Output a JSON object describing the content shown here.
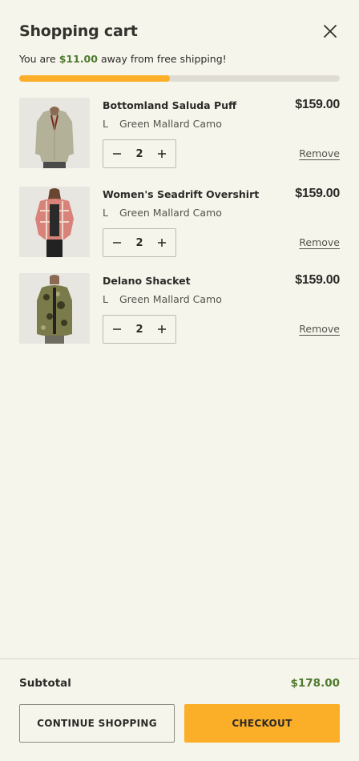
{
  "cart": {
    "title": "Shopping cart",
    "shipping_prefix": "You are",
    "shipping_amount": "$11.00",
    "shipping_suffix": "away from free shipping!",
    "shipping_progress_fraction": 0.47
  },
  "items": [
    {
      "name": "Bottomland Saluda Puff",
      "size": "L",
      "color": "Green Mallard Camo",
      "price": "$159.00",
      "quantity": "2",
      "remove_label": "Remove"
    },
    {
      "name": "Women's Seadrift Overshirt",
      "size": "L",
      "color": "Green Mallard Camo",
      "price": "$159.00",
      "quantity": "2",
      "remove_label": "Remove"
    },
    {
      "name": "Delano Shacket",
      "size": "L",
      "color": "Green Mallard Camo",
      "price": "$159.00",
      "quantity": "2",
      "remove_label": "Remove"
    }
  ],
  "footer": {
    "subtotal_label": "Subtotal",
    "subtotal_value": "$178.00",
    "continue_label": "CONTINUE SHOPPING",
    "checkout_label": "CHECKOUT"
  },
  "colors": {
    "accent": "#fbae28",
    "positive": "#4f7a2e",
    "background": "#f6f5ec"
  },
  "icons": {
    "close": "close-icon",
    "minus": "minus-icon",
    "plus": "plus-icon"
  }
}
